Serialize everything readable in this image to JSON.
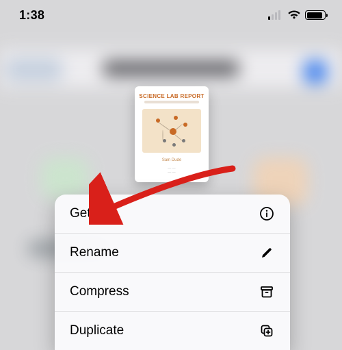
{
  "status_bar": {
    "time": "1:38"
  },
  "document": {
    "title": "SCIENCE LAB REPORT",
    "author": "Sam Dude"
  },
  "menu": {
    "items": [
      {
        "label": "Get Info",
        "icon": "info-circle-icon"
      },
      {
        "label": "Rename",
        "icon": "pencil-icon"
      },
      {
        "label": "Compress",
        "icon": "archivebox-icon"
      },
      {
        "label": "Duplicate",
        "icon": "duplicate-icon"
      }
    ]
  }
}
